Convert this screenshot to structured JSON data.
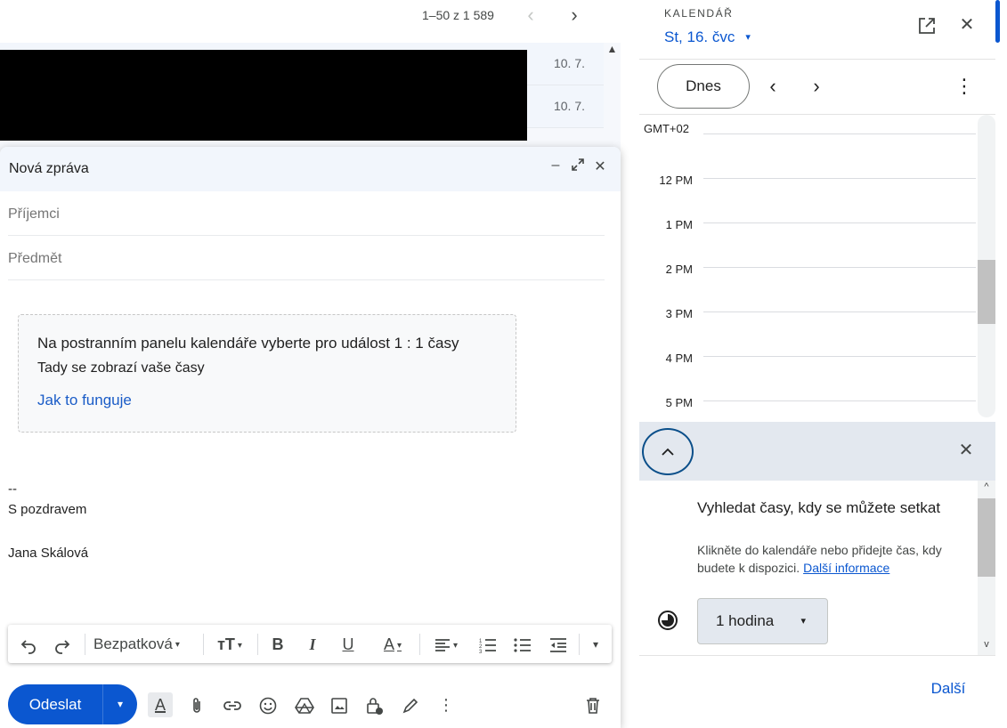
{
  "mail_list": {
    "pager_text": "1–50 z 1 589",
    "rows": [
      {
        "date": "10. 7."
      },
      {
        "date": "10. 7."
      }
    ]
  },
  "compose": {
    "title": "Nová zpráva",
    "recipients_placeholder": "Příjemci",
    "subject_placeholder": "Předmět",
    "info_title": "Na postranním panelu kalendáře vyberte pro událost 1 : 1 časy",
    "info_subtitle": "Tady se zobrazí vaše časy",
    "info_link": "Jak to funguje",
    "signature": [
      "--",
      "S pozdravem",
      "Jana Skálová"
    ],
    "font_name": "Bezpatková",
    "send_label": "Odeslat"
  },
  "calendar": {
    "label": "KALENDÁŘ",
    "date": "St, 16. čvc",
    "today_label": "Dnes",
    "timezone": "GMT+02",
    "hours": [
      "12 PM",
      "1 PM",
      "2 PM",
      "3 PM",
      "4 PM",
      "5 PM"
    ],
    "find": {
      "title": "Vyhledat časy, kdy se můžete setkat",
      "description": "Klikněte do kalendáře nebo přidejte čas, kdy budete k dispozici.",
      "more_info_link": "Další informace",
      "duration": "1 hodina",
      "next_label": "Další"
    }
  },
  "colors": {
    "accent": "#0b57d0",
    "list_background": "#f6f8fc",
    "panel_header": "#e3e8ef"
  },
  "icons": {
    "pager_prev": "‹",
    "pager_next": "›",
    "minimize": "–",
    "expand": "⤢",
    "close": "✕",
    "open_new": "⧉",
    "chevron_left": "‹",
    "chevron_right": "›",
    "more": "⋮",
    "chevron_up": "^",
    "caret": "▾"
  }
}
